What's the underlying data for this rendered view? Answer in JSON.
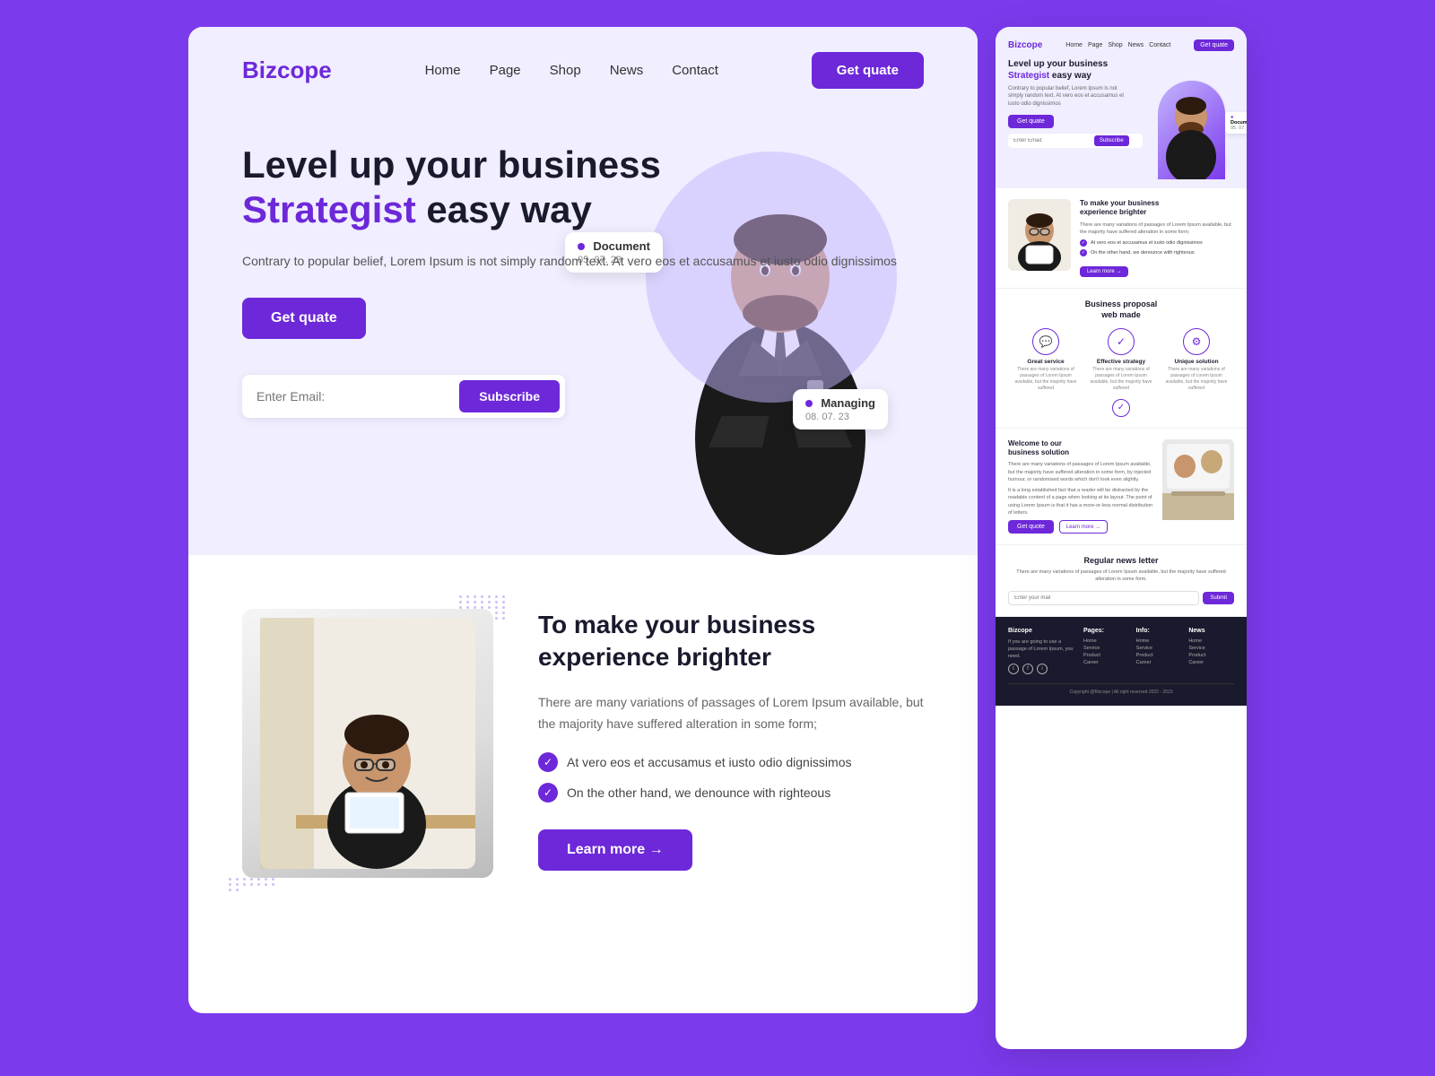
{
  "brand": {
    "logo": "Bizcope",
    "accent_color": "#6d28d9"
  },
  "nav": {
    "links": [
      "Home",
      "Page",
      "Shop",
      "News",
      "Contact"
    ],
    "cta": "Get quate"
  },
  "hero": {
    "title_line1": "Level up your business",
    "title_line2_highlight": "Strategist",
    "title_line2_rest": " easy way",
    "subtitle": "Contrary to popular belief, Lorem Ipsum is not simply random text. At vero eos et accusamus et iusto odio dignissimos",
    "cta_button": "Get quate",
    "email_placeholder": "Enter Email:",
    "subscribe_button": "Subscribe",
    "badge_document_label": "Document",
    "badge_document_date": "05. 07. 23",
    "badge_managing_label": "Managing",
    "badge_managing_date": "08. 07. 23"
  },
  "section2": {
    "title_line1": "To make your business",
    "title_line2": "experience brighter",
    "body": "There are many variations of passages of Lorem Ipsum available, but the majority have suffered alteration in some form;",
    "check_items": [
      "At vero eos et accusamus et iusto odio dignissimos",
      "On the other hand, we denounce with righteous"
    ],
    "learn_more": "Learn more →"
  },
  "proposal": {
    "title_line1": "Business proposal",
    "title_line2": "web made",
    "services": [
      {
        "icon": "💬",
        "title": "Great service",
        "desc": "There are many variations of passages of Lorem Ipsum available, but the majority have suffered"
      },
      {
        "icon": "✓",
        "title": "Effective strategy",
        "desc": "There are many variations of passages of Lorem Ipsum available, but the majority have suffered"
      },
      {
        "icon": "⚙",
        "title": "Unique solution",
        "desc": "There are many variations of passages of Lorem Ipsum available, but the majority have suffered"
      }
    ]
  },
  "welcome": {
    "title_line1": "Welcome to our",
    "title_line2": "business solution",
    "body1": "There are many variations of passages of Lorem Ipsum available, but the majority have suffered alteration in some form, by injected humour, or randomised words which don't look even slightly.",
    "body2": "It is a long established fact that a reader will be distracted by the readable content of a page when looking at its layout. The point of using Lorem Ipsum is that it has a more-or-less normal distribution of letters.",
    "get_quote_btn": "Get quote",
    "learn_more_btn": "Learn more →"
  },
  "newsletter": {
    "title": "Regular news letter",
    "body": "There are many variations of passages of Lorem Ipsum available, but the majority have suffered alteration in some form.",
    "email_placeholder": "Enter your mail",
    "submit_btn": "Submit"
  },
  "footer": {
    "brand": "Bizcope",
    "brand_desc": "If you are going to use a passage of Lorem Ipsum, you need.",
    "pages_title": "Pages:",
    "info_title": "Info:",
    "news_title": "News",
    "pages_links": [
      "Home",
      "Service",
      "Product",
      "Career"
    ],
    "info_links": [
      "Home",
      "Service",
      "Product",
      "Career"
    ],
    "news_links": [
      "Home",
      "Service",
      "Product",
      "Career"
    ],
    "copyright": "Copyright @Bizcope | All right reserved 2022 - 2023"
  }
}
